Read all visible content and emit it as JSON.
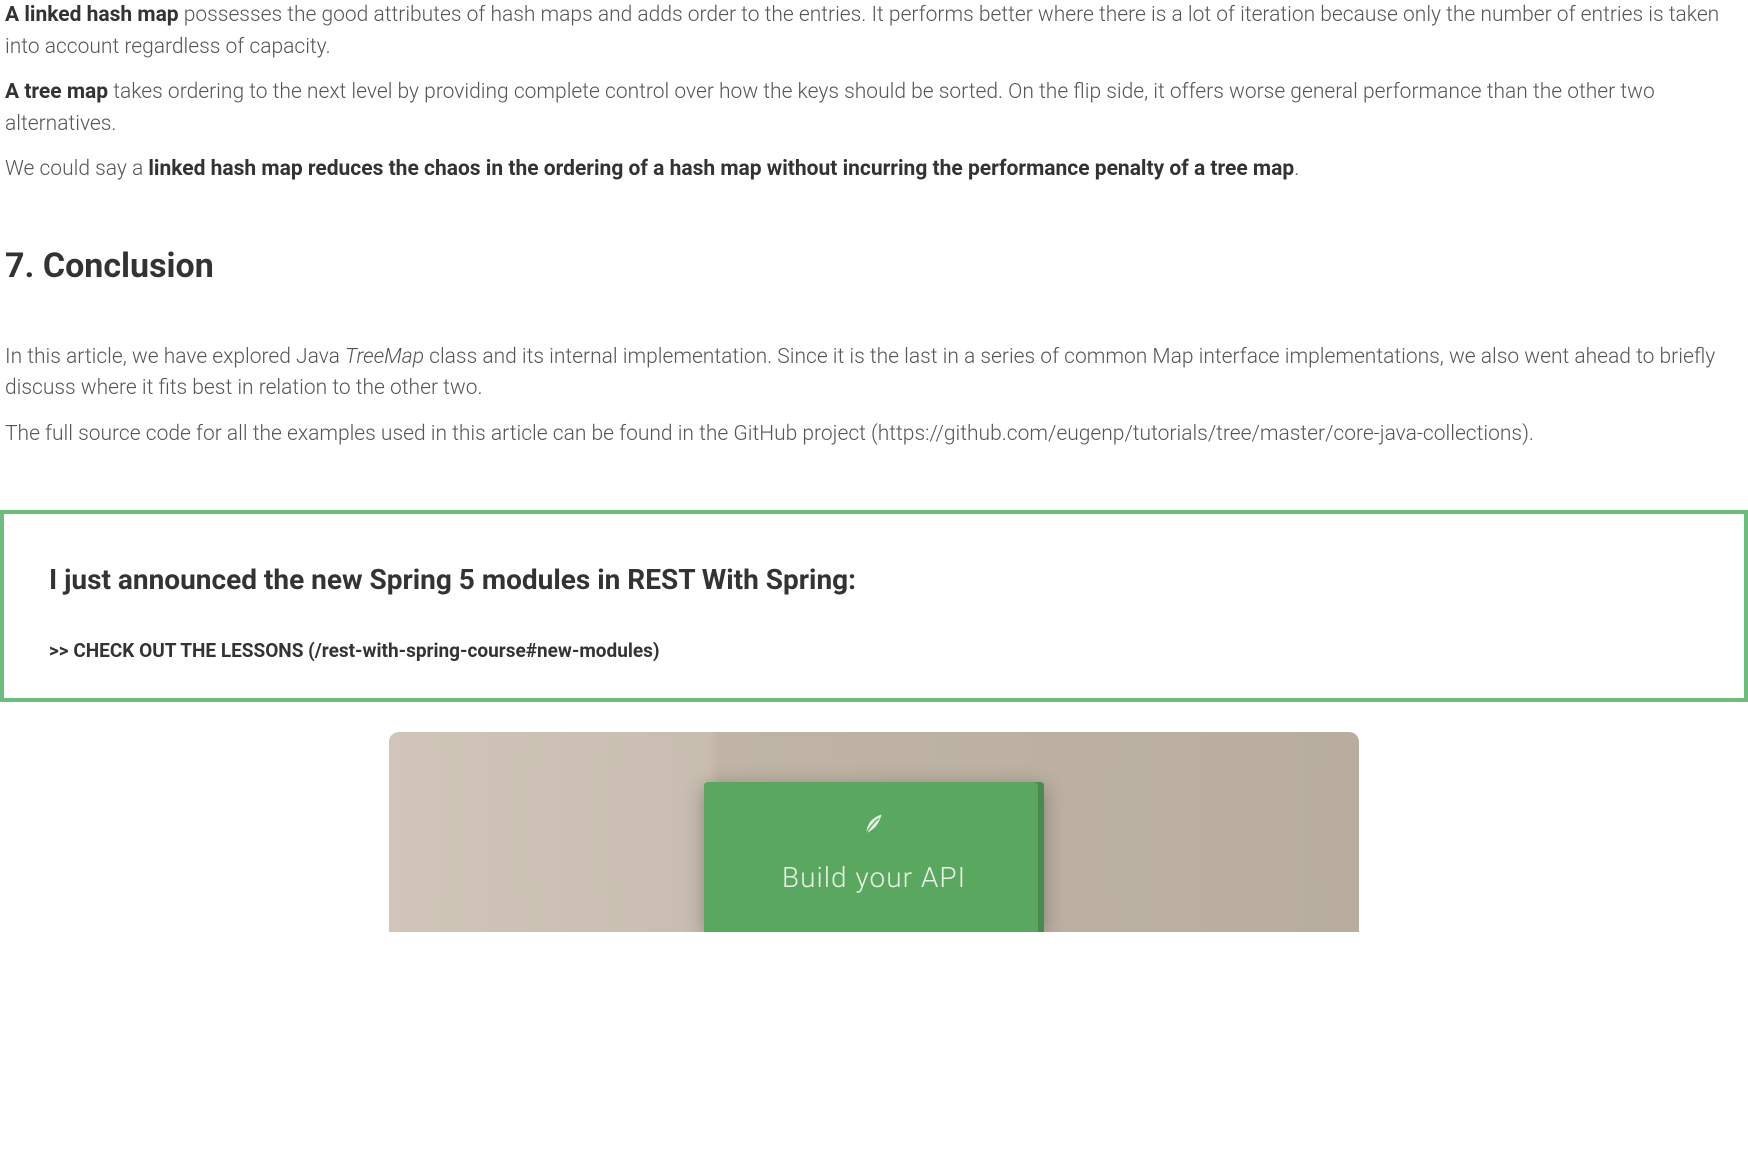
{
  "paragraphs": {
    "p1_bold": "A linked hash map",
    "p1_rest": " possesses the good attributes of hash maps and adds order to the entries. It performs better where there is a lot of iteration because only the number of entries is taken into account regardless of capacity.",
    "p2_bold": "A tree map",
    "p2_rest": " takes ordering to the next level by providing complete control over how the keys should be sorted. On the flip side, it offers worse general performance than the other two alternatives.",
    "p3_start": "We could say a ",
    "p3_bold": "linked hash map reduces the chaos in the ordering of a hash map without incurring the performance penalty of a tree map",
    "p3_end": "."
  },
  "heading": "7. Conclusion",
  "conclusion": {
    "p1_start": "In this article, we have explored Java ",
    "p1_italic": "TreeMap",
    "p1_rest": " class and its internal implementation. Since it is the last in a series of common Map interface implementations, we also went ahead to briefly discuss where it fits best in relation to the other two.",
    "p2_start": "The full source code for all the examples used in this article can be found in the ",
    "p2_link_text": "GitHub project (https://github.com/eugenp/tutorials/tree/master/core-java-collections)",
    "p2_end": "."
  },
  "callout": {
    "title": "I just announced the new Spring 5 modules in REST With Spring:",
    "link_text": ">> CHECK OUT THE LESSONS (/rest-with-spring-course#new-modules)"
  },
  "book": {
    "title": "Build your API"
  }
}
